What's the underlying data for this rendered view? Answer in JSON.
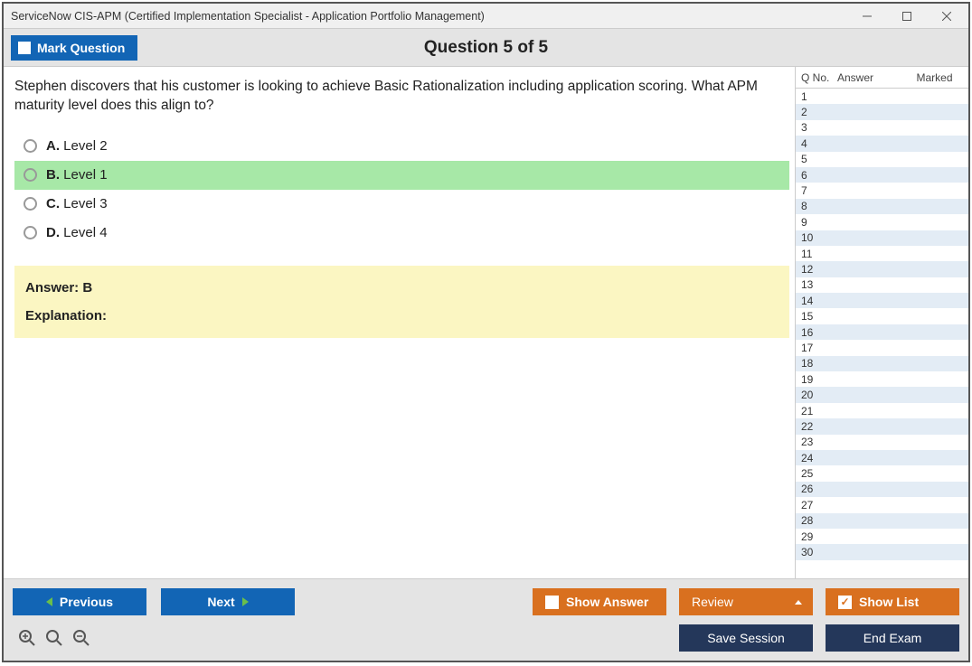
{
  "window": {
    "title": "ServiceNow CIS-APM (Certified Implementation Specialist - Application Portfolio Management)"
  },
  "header": {
    "mark_label": "Mark Question",
    "question_title": "Question 5 of 5"
  },
  "question": {
    "text": "Stephen discovers that his customer is looking to achieve Basic Rationalization including application scoring. What APM maturity level does this align to?",
    "options": [
      {
        "letter": "A.",
        "text": "Level 2",
        "correct": false
      },
      {
        "letter": "B.",
        "text": "Level 1",
        "correct": true
      },
      {
        "letter": "C.",
        "text": "Level 3",
        "correct": false
      },
      {
        "letter": "D.",
        "text": "Level 4",
        "correct": false
      }
    ]
  },
  "answer_box": {
    "answer_label": "Answer: B",
    "explanation_label": "Explanation:"
  },
  "side": {
    "col_q": "Q No.",
    "col_a": "Answer",
    "col_m": "Marked",
    "total_rows": 30
  },
  "footer": {
    "previous": "Previous",
    "next": "Next",
    "show_answer": "Show Answer",
    "review": "Review",
    "show_list": "Show List",
    "save_session": "Save Session",
    "end_exam": "End Exam"
  }
}
